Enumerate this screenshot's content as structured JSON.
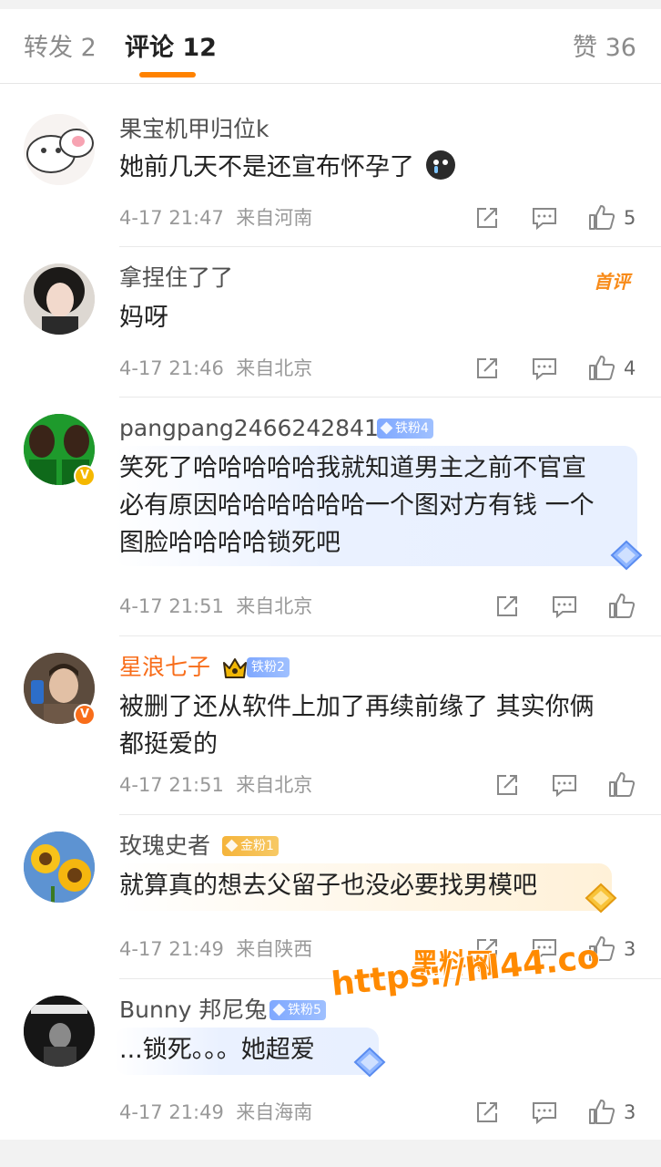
{
  "tabs": {
    "repost": "转发 2",
    "comments": "评论 12",
    "likes": "赞 36"
  },
  "colors": {
    "accent": "#ff8200",
    "vip_name": "#f86d1a"
  },
  "comments": [
    {
      "name": "果宝机甲归位k",
      "text_lines": [
        "她前几天不是还宣布怀孕了"
      ],
      "time": "4-17 21:47",
      "location": "来自河南",
      "likes": "5"
    },
    {
      "name": "拿捏住了了",
      "first_badge": "首评",
      "text_lines": [
        "妈呀"
      ],
      "time": "4-17 21:46",
      "location": "来自北京",
      "likes": "4"
    },
    {
      "name": "pangpang2466242841",
      "fan_badge": "铁粉4",
      "text_lines": [
        "笑死了哈哈哈哈哈我就知道男主之前不官宣",
        "必有原因哈哈哈哈哈哈一个图对方有钱 一个",
        "图脸哈哈哈哈锁死吧"
      ],
      "time": "4-17 21:51",
      "location": "来自北京",
      "likes": ""
    },
    {
      "name": "星浪七子",
      "fan_badge": "铁粉2",
      "text_lines": [
        "被删了还从软件上加了再续前缘了 其实你俩",
        "都挺爱的"
      ],
      "time": "4-17 21:51",
      "location": "来自北京",
      "likes": ""
    },
    {
      "name": "玫瑰史者",
      "fan_badge": "金粉1",
      "text_lines": [
        "就算真的想去父留子也没必要找男模吧"
      ],
      "time": "4-17 21:49",
      "location": "来自陕西",
      "likes": "3"
    },
    {
      "name": "Bunny 邦尼兔",
      "fan_badge": "铁粉5",
      "text_lines": [
        "...锁死。。。她超爱"
      ],
      "time": "4-17 21:49",
      "location": "来自海南",
      "likes": "3"
    }
  ],
  "watermark": {
    "line1": "黑料网",
    "line2": "https://hl44.co"
  }
}
